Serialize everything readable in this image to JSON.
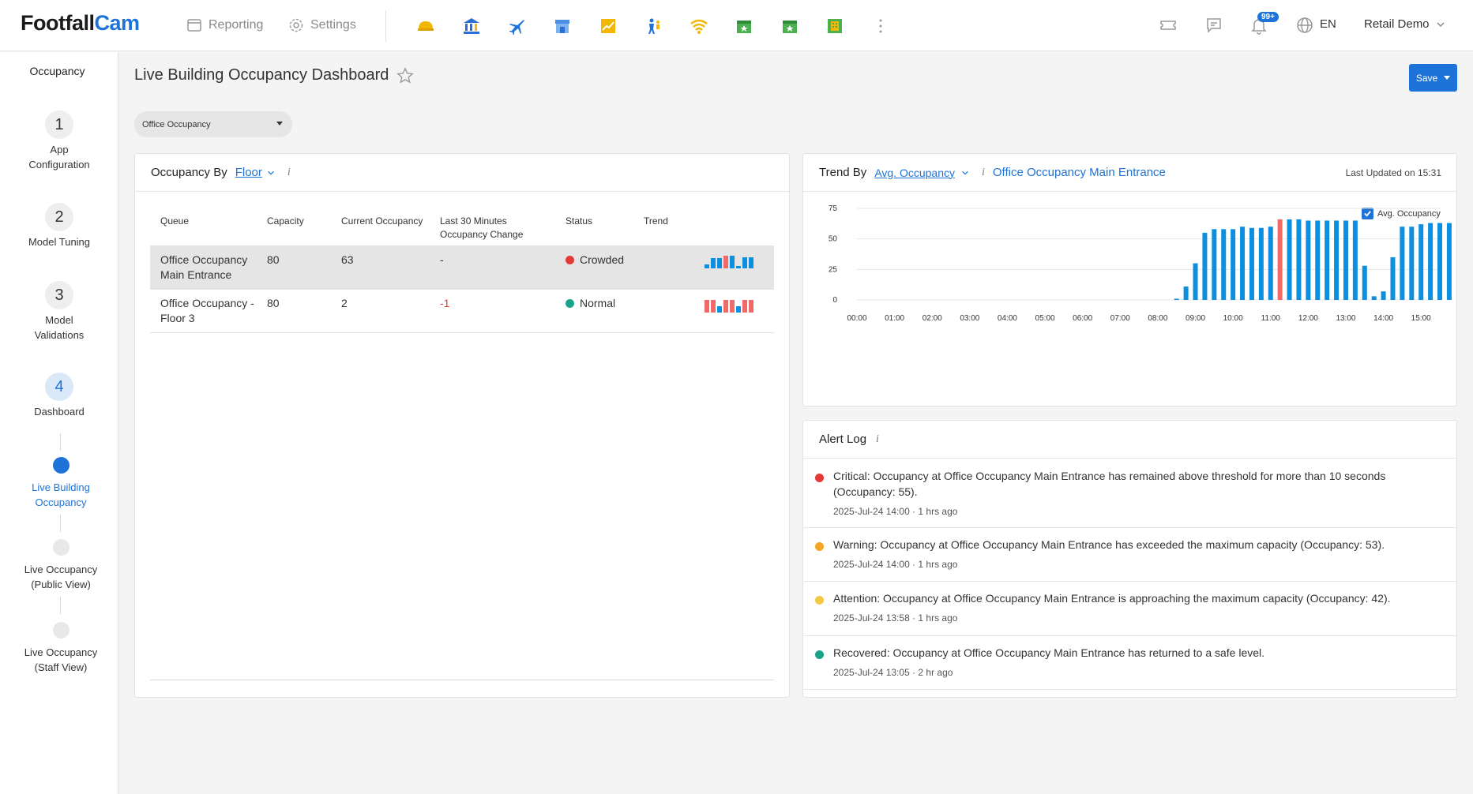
{
  "brand": {
    "part1": "Footfall",
    "part2": "Cam"
  },
  "topnav": {
    "reporting": "Reporting",
    "settings": "Settings"
  },
  "app_icons": [
    "helmet-icon",
    "bank-icon",
    "airplane-icon",
    "store-icon",
    "chart-icon",
    "people-icon",
    "wifi-icon",
    "calendar-star-icon",
    "calendar-star-icon",
    "building-icon",
    "more-icon"
  ],
  "notifications_badge": "99+",
  "language": "EN",
  "user": "Retail Demo",
  "sidebar": {
    "title": "Occupancy",
    "steps": [
      {
        "num": "1",
        "label": "App Configuration"
      },
      {
        "num": "2",
        "label": "Model Tuning"
      },
      {
        "num": "3",
        "label": "Model Validations"
      },
      {
        "num": "4",
        "label": "Dashboard"
      }
    ],
    "subitems": [
      {
        "label": "Live Building Occupancy",
        "active": true
      },
      {
        "label": "Live Occupancy (Public View)",
        "active": false
      },
      {
        "label": "Live Occupancy (Staff View)",
        "active": false
      }
    ]
  },
  "page": {
    "title": "Live Building Occupancy Dashboard",
    "save": "Save",
    "selector": "Office Occupancy"
  },
  "occupancy_panel": {
    "title": "Occupancy By",
    "group_by": "Floor",
    "columns": [
      "Queue",
      "Capacity",
      "Current Occupancy",
      "Last 30 Minutes Occupancy Change",
      "Status",
      "Trend"
    ],
    "rows": [
      {
        "queue": "Office Occupancy Main Entrance",
        "capacity": "80",
        "current": "63",
        "change": "-",
        "status": "Crowded",
        "status_color": "#e53935",
        "trend": [
          {
            "v": 0.3,
            "c": "#0d8fe0"
          },
          {
            "v": 0.8,
            "c": "#0d8fe0"
          },
          {
            "v": 0.8,
            "c": "#0d8fe0"
          },
          {
            "v": 1.0,
            "c": "#f06a6a"
          },
          {
            "v": 1.0,
            "c": "#0d8fe0"
          },
          {
            "v": 0.2,
            "c": "#0d8fe0"
          },
          {
            "v": 0.9,
            "c": "#0d8fe0"
          },
          {
            "v": 0.9,
            "c": "#0d8fe0"
          }
        ]
      },
      {
        "queue": "Office Occupancy - Floor 3",
        "capacity": "80",
        "current": "2",
        "change": "-1",
        "status": "Normal",
        "status_color": "#1aa38a",
        "trend": [
          {
            "v": 1.0,
            "c": "#f06a6a"
          },
          {
            "v": 1.0,
            "c": "#f06a6a"
          },
          {
            "v": 0.5,
            "c": "#0d8fe0"
          },
          {
            "v": 1.0,
            "c": "#f06a6a"
          },
          {
            "v": 1.0,
            "c": "#f06a6a"
          },
          {
            "v": 0.5,
            "c": "#0d8fe0"
          },
          {
            "v": 1.0,
            "c": "#f06a6a"
          },
          {
            "v": 1.0,
            "c": "#f06a6a"
          }
        ]
      }
    ]
  },
  "trend_panel": {
    "title": "Trend By",
    "metric": "Avg. Occupancy",
    "location": "Office Occupancy Main Entrance",
    "last_updated": "Last Updated on 15:31",
    "legend": "Avg. Occupancy"
  },
  "chart_data": {
    "type": "bar",
    "x_ticks": [
      "00:00",
      "01:00",
      "02:00",
      "03:00",
      "04:00",
      "05:00",
      "06:00",
      "07:00",
      "08:00",
      "09:00",
      "10:00",
      "11:00",
      "12:00",
      "13:00",
      "14:00",
      "15:00"
    ],
    "y_ticks": [
      0,
      25,
      50,
      75
    ],
    "ylim": [
      0,
      75
    ],
    "xlim": [
      0,
      15.5
    ],
    "series": [
      {
        "name": "Avg. Occupancy",
        "color": "#0d8fe0",
        "highlight_color": "#f06a6a",
        "points": [
          {
            "x": 8.5,
            "y": 1
          },
          {
            "x": 8.75,
            "y": 11
          },
          {
            "x": 9.0,
            "y": 30
          },
          {
            "x": 9.25,
            "y": 55
          },
          {
            "x": 9.5,
            "y": 58
          },
          {
            "x": 9.75,
            "y": 58
          },
          {
            "x": 10.0,
            "y": 58
          },
          {
            "x": 10.25,
            "y": 60
          },
          {
            "x": 10.5,
            "y": 59
          },
          {
            "x": 10.75,
            "y": 59
          },
          {
            "x": 11.0,
            "y": 60
          },
          {
            "x": 11.25,
            "y": 66,
            "highlight": true
          },
          {
            "x": 11.5,
            "y": 66
          },
          {
            "x": 11.75,
            "y": 66
          },
          {
            "x": 12.0,
            "y": 65
          },
          {
            "x": 12.25,
            "y": 65
          },
          {
            "x": 12.5,
            "y": 65
          },
          {
            "x": 12.75,
            "y": 65
          },
          {
            "x": 13.0,
            "y": 65
          },
          {
            "x": 13.25,
            "y": 65
          },
          {
            "x": 13.5,
            "y": 28
          },
          {
            "x": 13.75,
            "y": 3
          },
          {
            "x": 14.0,
            "y": 7
          },
          {
            "x": 14.25,
            "y": 35
          },
          {
            "x": 14.5,
            "y": 60
          },
          {
            "x": 14.75,
            "y": 60
          },
          {
            "x": 15.0,
            "y": 62
          },
          {
            "x": 15.25,
            "y": 63
          },
          {
            "x": 15.5,
            "y": 63
          },
          {
            "x": 15.75,
            "y": 63
          }
        ]
      }
    ]
  },
  "alert_log": {
    "title": "Alert Log",
    "items": [
      {
        "color": "#e53935",
        "message": "Critical: Occupancy at Office Occupancy Main Entrance has remained above threshold for more than 10 seconds (Occupancy: 55).",
        "time": "2025-Jul-24 14:00 · 1 hrs ago"
      },
      {
        "color": "#f5a623",
        "message": "Warning: Occupancy at Office Occupancy Main Entrance has exceeded the maximum capacity (Occupancy: 53).",
        "time": "2025-Jul-24 14:00 · 1 hrs ago"
      },
      {
        "color": "#f5c842",
        "message": "Attention: Occupancy at Office Occupancy Main Entrance is approaching the maximum capacity (Occupancy: 42).",
        "time": "2025-Jul-24 13:58 · 1 hrs ago"
      },
      {
        "color": "#1aa38a",
        "message": "Recovered: Occupancy at Office Occupancy Main Entrance has returned to a safe level.",
        "time": "2025-Jul-24 13:05 · 2 hr ago"
      }
    ]
  }
}
